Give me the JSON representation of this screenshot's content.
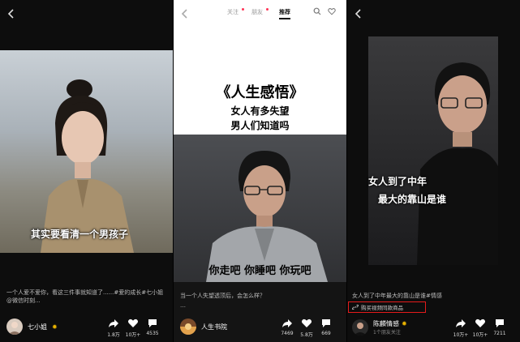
{
  "panel1": {
    "subtitle": "其实要看清一个男孩子",
    "caption": "一个人爱不爱你，看这三件事就知道了......#爱的成长#七小姐@微信时刻...",
    "author": "七小姐",
    "likes": "1.8万",
    "comments": "10万+",
    "shares": "4535"
  },
  "panel2": {
    "tabs": [
      "关注",
      "朋友",
      "推荐"
    ],
    "title": "《人生感悟》",
    "line1": "女人有多失望",
    "line2": "男人们知道吗",
    "subtitle": "你走吧 你睡吧 你玩吧",
    "caption": "当一个人失望透顶后，会怎么样？",
    "author": "人生书院",
    "likes": "7469",
    "comments": "5.8万",
    "shares": "669"
  },
  "panel3": {
    "subtitle1": "女人到了中年",
    "subtitle2": "最大的靠山是谁",
    "caption": "女人到了中年最大的靠山是谁#情感",
    "shop_label": "购买视频同款商品",
    "author": "陈麟情感",
    "fans": "1个朋友关注",
    "likes": "10万+",
    "comments": "10万+",
    "shares": "7211"
  },
  "colors": {
    "accent": "#e51b1b",
    "verified": "#e9b200",
    "notify": "#ff3355"
  },
  "icons": [
    "back-icon",
    "share-icon",
    "heart-icon",
    "comment-icon",
    "search-icon",
    "heart-outline-icon",
    "link-icon"
  ]
}
